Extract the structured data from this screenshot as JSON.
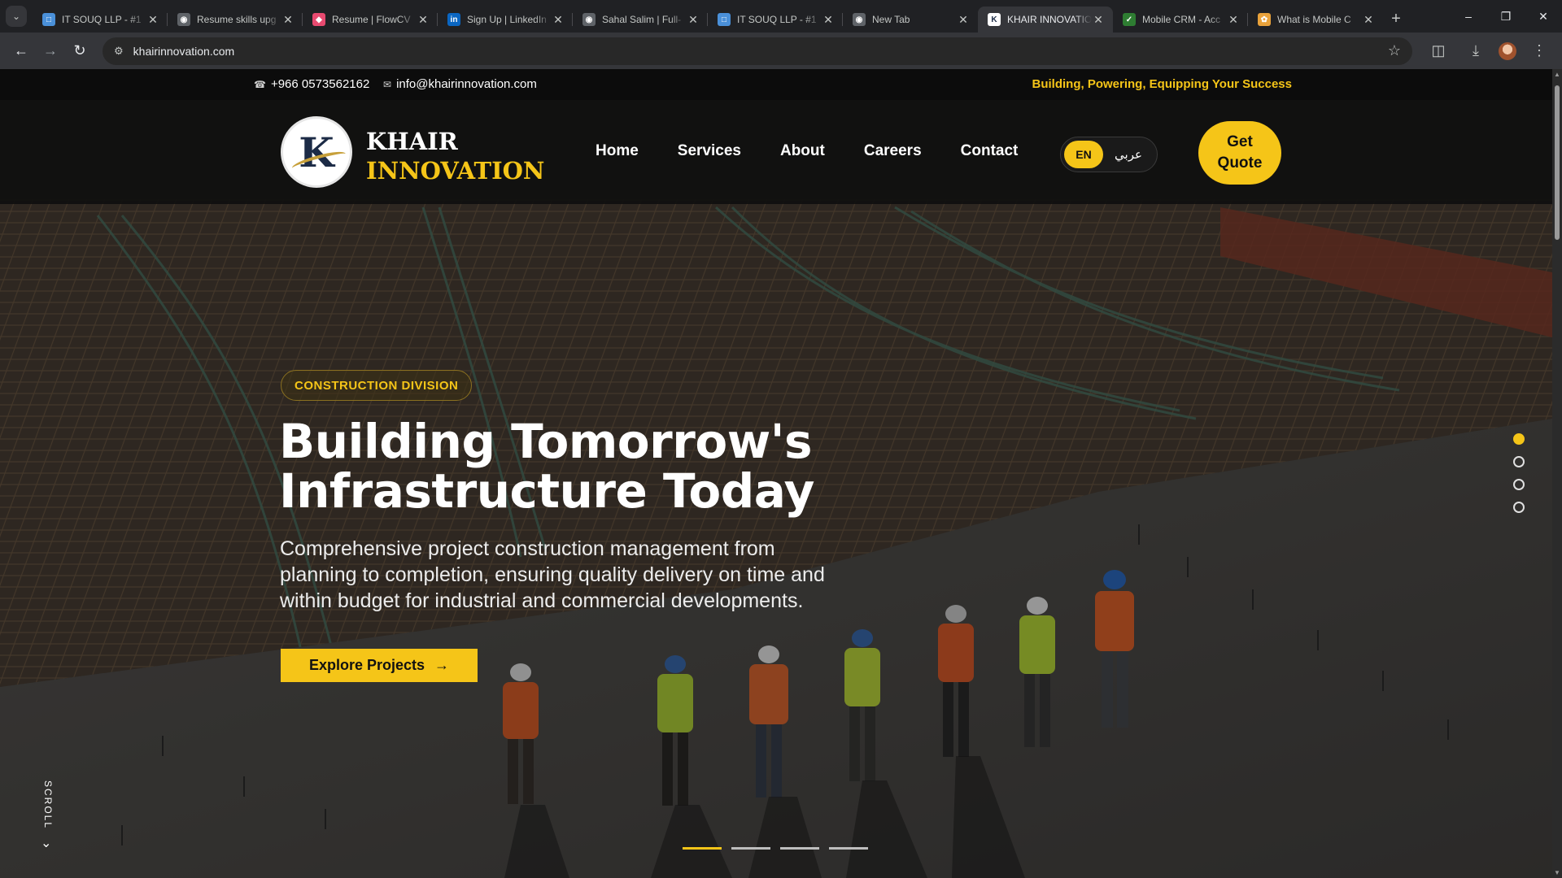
{
  "browser": {
    "tabs": [
      {
        "title": "IT SOUQ LLP - #1",
        "icon": "blue-app-icon",
        "color": "#4a90d9"
      },
      {
        "title": "Resume skills upg",
        "icon": "globe-icon",
        "color": "#5f6368"
      },
      {
        "title": "Resume | FlowCV",
        "icon": "flowcv-icon",
        "color": "#e84a70"
      },
      {
        "title": "Sign Up | LinkedIn",
        "icon": "linkedin-icon",
        "color": "#0a66c2"
      },
      {
        "title": "Sahal Salim | Full-",
        "icon": "globe-icon",
        "color": "#5f6368"
      },
      {
        "title": "IT SOUQ LLP - #1",
        "icon": "blue-app-icon",
        "color": "#4a90d9"
      },
      {
        "title": "New Tab",
        "icon": "chrome-icon",
        "color": "#5f6368"
      },
      {
        "title": "KHAIR INNOVATIO",
        "icon": "khair-icon",
        "color": "#ffffff",
        "active": true
      },
      {
        "title": "Mobile CRM - Acc",
        "icon": "crm-icon",
        "color": "#2e7d32"
      },
      {
        "title": "What is Mobile C",
        "icon": "chatgpt-icon",
        "color": "#e9a23b"
      }
    ],
    "url": "khairinnovation.com"
  },
  "topbar": {
    "phone": "+966 0573562162",
    "email": "info@khairinnovation.com",
    "tagline": "Building, Powering, Equipping Your Success"
  },
  "header": {
    "logo_letter": "K",
    "brand_line1": "KHAIR",
    "brand_line2": "INNOVATION",
    "nav": [
      "Home",
      "Services",
      "About",
      "Careers",
      "Contact"
    ],
    "lang_en": "EN",
    "lang_ar": "عربي",
    "cta_line1": "Get",
    "cta_line2": "Quote"
  },
  "hero": {
    "badge": "CONSTRUCTION DIVISION",
    "title_line1": "Building Tomorrow's",
    "title_line2": "Infrastructure Today",
    "desc_line1": "Comprehensive project construction management from",
    "desc_line2": "planning to completion, ensuring quality delivery on time and",
    "desc_line3": "within budget for industrial and commercial developments.",
    "button": "Explore Projects",
    "scroll_label": "SCROLL",
    "slides": 4,
    "active_slide": 1
  },
  "colors": {
    "accent": "#f5c518",
    "topbar_bg": "#0c0c0c",
    "header_bg": "#0e0e0e"
  }
}
